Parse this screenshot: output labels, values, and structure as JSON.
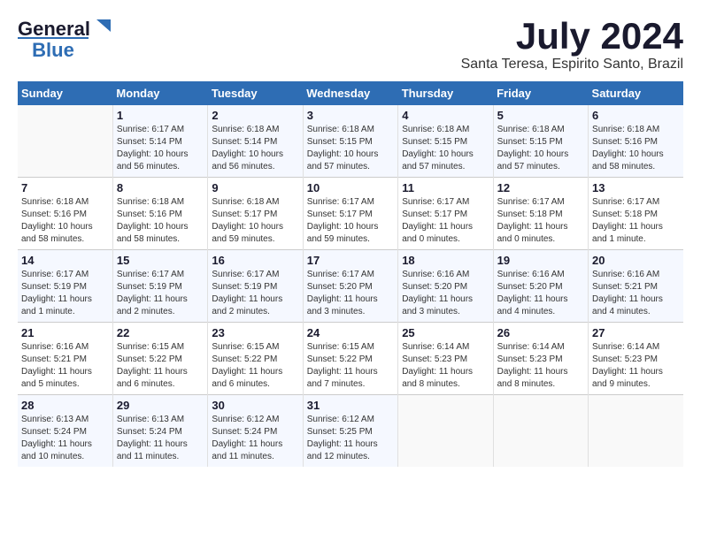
{
  "header": {
    "logo_line1": "General",
    "logo_line2": "Blue",
    "title": "July 2024",
    "subtitle": "Santa Teresa, Espirito Santo, Brazil"
  },
  "weekdays": [
    "Sunday",
    "Monday",
    "Tuesday",
    "Wednesday",
    "Thursday",
    "Friday",
    "Saturday"
  ],
  "weeks": [
    [
      {
        "day": "",
        "info": ""
      },
      {
        "day": "1",
        "info": "Sunrise: 6:17 AM\nSunset: 5:14 PM\nDaylight: 10 hours\nand 56 minutes."
      },
      {
        "day": "2",
        "info": "Sunrise: 6:18 AM\nSunset: 5:14 PM\nDaylight: 10 hours\nand 56 minutes."
      },
      {
        "day": "3",
        "info": "Sunrise: 6:18 AM\nSunset: 5:15 PM\nDaylight: 10 hours\nand 57 minutes."
      },
      {
        "day": "4",
        "info": "Sunrise: 6:18 AM\nSunset: 5:15 PM\nDaylight: 10 hours\nand 57 minutes."
      },
      {
        "day": "5",
        "info": "Sunrise: 6:18 AM\nSunset: 5:15 PM\nDaylight: 10 hours\nand 57 minutes."
      },
      {
        "day": "6",
        "info": "Sunrise: 6:18 AM\nSunset: 5:16 PM\nDaylight: 10 hours\nand 58 minutes."
      }
    ],
    [
      {
        "day": "7",
        "info": "Sunrise: 6:18 AM\nSunset: 5:16 PM\nDaylight: 10 hours\nand 58 minutes."
      },
      {
        "day": "8",
        "info": "Sunrise: 6:18 AM\nSunset: 5:16 PM\nDaylight: 10 hours\nand 58 minutes."
      },
      {
        "day": "9",
        "info": "Sunrise: 6:18 AM\nSunset: 5:17 PM\nDaylight: 10 hours\nand 59 minutes."
      },
      {
        "day": "10",
        "info": "Sunrise: 6:17 AM\nSunset: 5:17 PM\nDaylight: 10 hours\nand 59 minutes."
      },
      {
        "day": "11",
        "info": "Sunrise: 6:17 AM\nSunset: 5:17 PM\nDaylight: 11 hours\nand 0 minutes."
      },
      {
        "day": "12",
        "info": "Sunrise: 6:17 AM\nSunset: 5:18 PM\nDaylight: 11 hours\nand 0 minutes."
      },
      {
        "day": "13",
        "info": "Sunrise: 6:17 AM\nSunset: 5:18 PM\nDaylight: 11 hours\nand 1 minute."
      }
    ],
    [
      {
        "day": "14",
        "info": "Sunrise: 6:17 AM\nSunset: 5:19 PM\nDaylight: 11 hours\nand 1 minute."
      },
      {
        "day": "15",
        "info": "Sunrise: 6:17 AM\nSunset: 5:19 PM\nDaylight: 11 hours\nand 2 minutes."
      },
      {
        "day": "16",
        "info": "Sunrise: 6:17 AM\nSunset: 5:19 PM\nDaylight: 11 hours\nand 2 minutes."
      },
      {
        "day": "17",
        "info": "Sunrise: 6:17 AM\nSunset: 5:20 PM\nDaylight: 11 hours\nand 3 minutes."
      },
      {
        "day": "18",
        "info": "Sunrise: 6:16 AM\nSunset: 5:20 PM\nDaylight: 11 hours\nand 3 minutes."
      },
      {
        "day": "19",
        "info": "Sunrise: 6:16 AM\nSunset: 5:20 PM\nDaylight: 11 hours\nand 4 minutes."
      },
      {
        "day": "20",
        "info": "Sunrise: 6:16 AM\nSunset: 5:21 PM\nDaylight: 11 hours\nand 4 minutes."
      }
    ],
    [
      {
        "day": "21",
        "info": "Sunrise: 6:16 AM\nSunset: 5:21 PM\nDaylight: 11 hours\nand 5 minutes."
      },
      {
        "day": "22",
        "info": "Sunrise: 6:15 AM\nSunset: 5:22 PM\nDaylight: 11 hours\nand 6 minutes."
      },
      {
        "day": "23",
        "info": "Sunrise: 6:15 AM\nSunset: 5:22 PM\nDaylight: 11 hours\nand 6 minutes."
      },
      {
        "day": "24",
        "info": "Sunrise: 6:15 AM\nSunset: 5:22 PM\nDaylight: 11 hours\nand 7 minutes."
      },
      {
        "day": "25",
        "info": "Sunrise: 6:14 AM\nSunset: 5:23 PM\nDaylight: 11 hours\nand 8 minutes."
      },
      {
        "day": "26",
        "info": "Sunrise: 6:14 AM\nSunset: 5:23 PM\nDaylight: 11 hours\nand 8 minutes."
      },
      {
        "day": "27",
        "info": "Sunrise: 6:14 AM\nSunset: 5:23 PM\nDaylight: 11 hours\nand 9 minutes."
      }
    ],
    [
      {
        "day": "28",
        "info": "Sunrise: 6:13 AM\nSunset: 5:24 PM\nDaylight: 11 hours\nand 10 minutes."
      },
      {
        "day": "29",
        "info": "Sunrise: 6:13 AM\nSunset: 5:24 PM\nDaylight: 11 hours\nand 11 minutes."
      },
      {
        "day": "30",
        "info": "Sunrise: 6:12 AM\nSunset: 5:24 PM\nDaylight: 11 hours\nand 11 minutes."
      },
      {
        "day": "31",
        "info": "Sunrise: 6:12 AM\nSunset: 5:25 PM\nDaylight: 11 hours\nand 12 minutes."
      },
      {
        "day": "",
        "info": ""
      },
      {
        "day": "",
        "info": ""
      },
      {
        "day": "",
        "info": ""
      }
    ]
  ]
}
